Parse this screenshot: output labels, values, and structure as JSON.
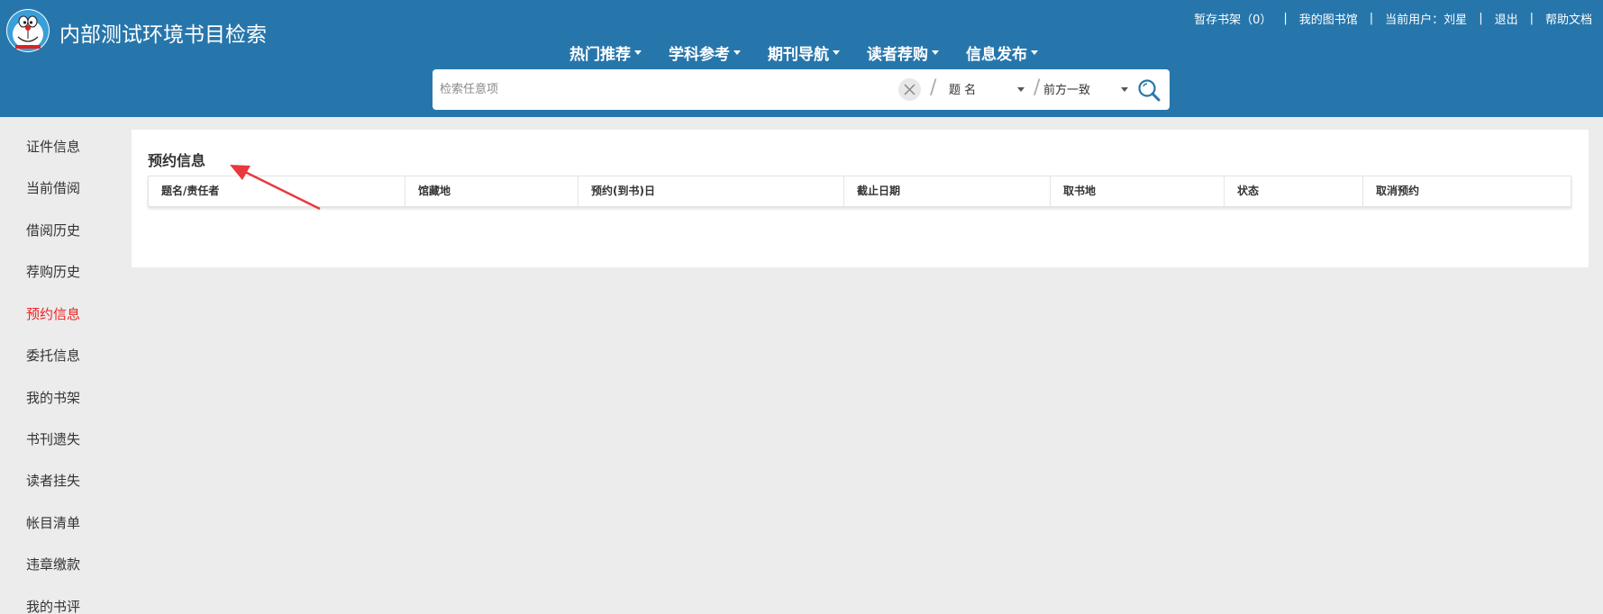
{
  "header": {
    "title": "内部测试环境书目检索",
    "toplinks": {
      "shelf": "暂存书架（0）",
      "my_library": "我的图书馆",
      "current_user_label": "当前用户：",
      "user_name": "刘星",
      "logout": "退出",
      "help": "帮助文档",
      "separator": "|"
    },
    "nav": [
      "热门推荐",
      "学科参考",
      "期刊导航",
      "读者荐购",
      "信息发布"
    ]
  },
  "search": {
    "placeholder": "检索任意项",
    "value": "",
    "field": "题 名",
    "match": "前方一致",
    "slash": "/"
  },
  "sidebar": {
    "items": [
      {
        "label": "证件信息"
      },
      {
        "label": "当前借阅"
      },
      {
        "label": "借阅历史"
      },
      {
        "label": "荐购历史"
      },
      {
        "label": "预约信息",
        "active": true
      },
      {
        "label": "委托信息"
      },
      {
        "label": "我的书架"
      },
      {
        "label": "书刊遗失"
      },
      {
        "label": "读者挂失"
      },
      {
        "label": "帐目清单"
      },
      {
        "label": "违章缴款"
      },
      {
        "label": "我的书评"
      }
    ]
  },
  "main": {
    "title": "预约信息",
    "columns": [
      "题名/责任者",
      "馆藏地",
      "预约(到书)日",
      "截止日期",
      "取书地",
      "状态",
      "取消预约"
    ]
  },
  "colors": {
    "header_bg": "#2776ab",
    "active": "#e22",
    "annotation_arrow": "#e8393f"
  }
}
